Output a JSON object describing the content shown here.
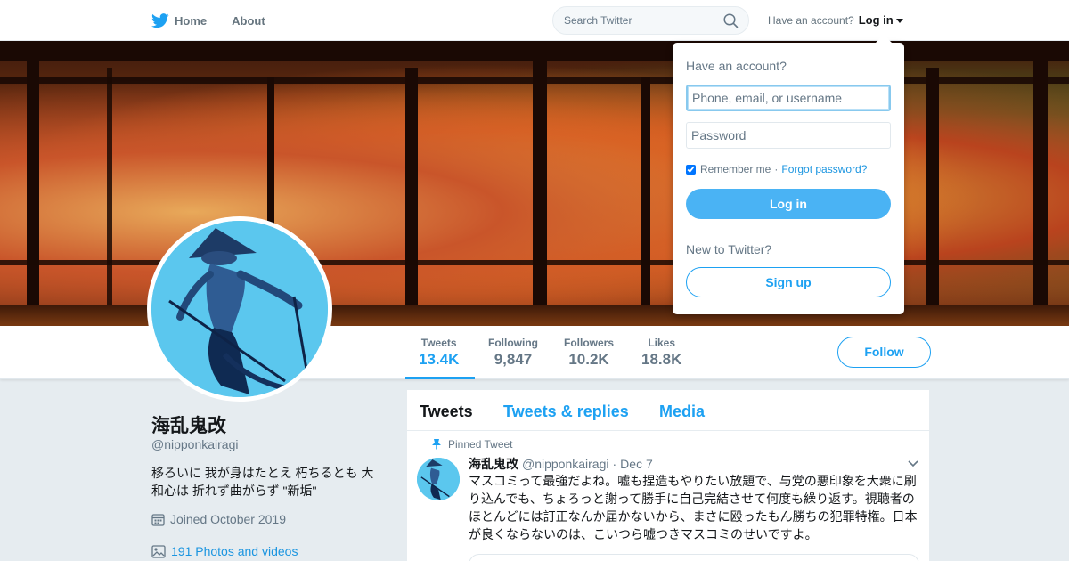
{
  "topbar": {
    "home_label": "Home",
    "about_label": "About",
    "search_placeholder": "Search Twitter",
    "have_account": "Have an account?",
    "login_label": "Log in"
  },
  "profile": {
    "name": "海乱鬼改",
    "handle": "@nipponkairagi",
    "bio": "移ろいに 我が身はたとえ 朽ちるとも 大和心は 折れず曲がらず \"新垢\"",
    "joined": "Joined October 2019",
    "photos": "191 Photos and videos"
  },
  "stats": [
    {
      "label": "Tweets",
      "value": "13.4K",
      "active": true
    },
    {
      "label": "Following",
      "value": "9,847"
    },
    {
      "label": "Followers",
      "value": "10.2K"
    },
    {
      "label": "Likes",
      "value": "18.8K"
    }
  ],
  "follow_label": "Follow",
  "timeline": {
    "tabs": [
      "Tweets",
      "Tweets & replies",
      "Media"
    ],
    "pinned_label": "Pinned Tweet",
    "tweet": {
      "name": "海乱鬼改",
      "handle": "@nipponkairagi",
      "date": "Dec 7",
      "text": "マスコミって最強だよね。嘘も捏造もやりたい放題で、与党の悪印象を大衆に刷り込んでも、ちょろっと謝って勝手に自己完結させて何度も繰り返す。視聴者のほとんどには訂正なんか届かないから、まさに殴ったもん勝ちの犯罪特権。日本が良くならないのは、こいつら嘘つきマスコミのせいですよ。"
    }
  },
  "login_dropdown": {
    "title": "Have an account?",
    "username_placeholder": "Phone, email, or username",
    "password_placeholder": "Password",
    "remember_label": "Remember me",
    "separator": "·",
    "forgot_label": "Forgot password?",
    "login_button": "Log in",
    "new_label": "New to Twitter?",
    "signup_button": "Sign up"
  },
  "colors": {
    "accent": "#1da1f2",
    "background": "#e6ecf0"
  }
}
